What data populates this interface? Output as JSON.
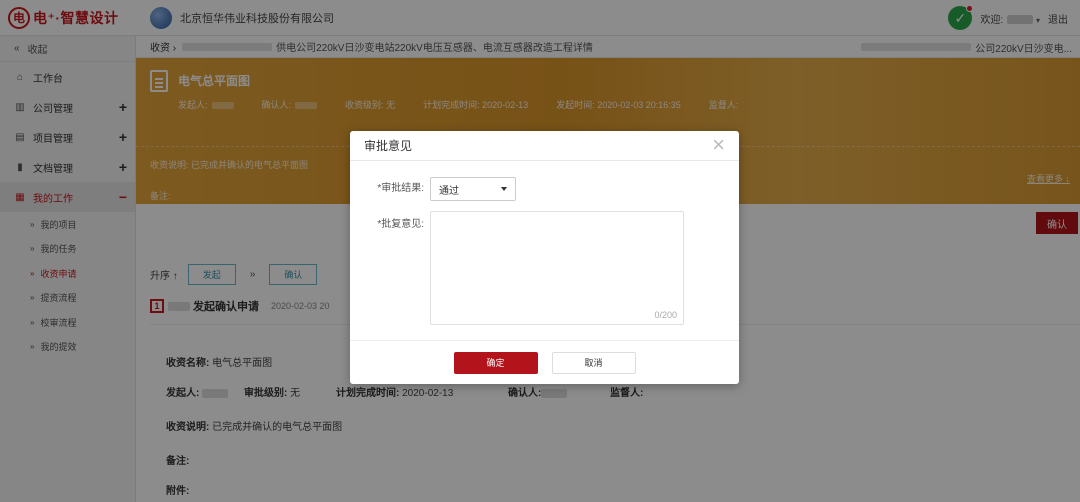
{
  "app": {
    "brand_logo_char": "电",
    "brand_text": "电⁺·智慧设计",
    "company_name": "北京恒华伟业科技股份有限公司",
    "welcome_label": "欢迎:",
    "logout_label": "退出"
  },
  "sidebar": {
    "collapse_label": "收起",
    "items": [
      {
        "label": "工作台",
        "icon": "home-icon"
      },
      {
        "label": "公司管理",
        "icon": "company-icon"
      },
      {
        "label": "项目管理",
        "icon": "project-icon"
      },
      {
        "label": "文档管理",
        "icon": "document-icon"
      },
      {
        "label": "我的工作",
        "icon": "work-icon"
      }
    ],
    "sub_items": [
      {
        "label": "我的项目"
      },
      {
        "label": "我的任务"
      },
      {
        "label": "收资申请"
      },
      {
        "label": "提资流程"
      },
      {
        "label": "校审流程"
      },
      {
        "label": "我的提效"
      }
    ]
  },
  "breadcrumb": {
    "home": "收资",
    "path_text": "供电公司220kV日沙变电站220kV电压互感器、电流互感器改造工程详情",
    "right_text": "公司220kV日沙变电..."
  },
  "banner": {
    "title": "电气总平面图",
    "meta": [
      {
        "label": "发起人:"
      },
      {
        "label": "确认人:"
      },
      {
        "label": "收资级别:",
        "value": "无"
      },
      {
        "label": "计划完成时间:",
        "value": "2020-02-13"
      },
      {
        "label": "发起时间:",
        "value": "2020-02-03 20:16:35"
      },
      {
        "label": "监督人:"
      }
    ],
    "desc": "收资说明: 已完成并确认的电气总平面图",
    "note_label": "备注:",
    "attach_label": "附件(0)",
    "more_link": "查看更多 ↓"
  },
  "confirm_button": "确认",
  "steps": {
    "sort_label": "升序",
    "step1": "发起",
    "separator": "»",
    "step2": "确认"
  },
  "record": {
    "number": "1",
    "title": "发起确认申请",
    "date": "2020-02-03 20",
    "name_label": "收资名称:",
    "name_value": "电气总平面图",
    "initiator_label": "发起人:",
    "level_label": "审批级别:",
    "level_value": "无",
    "plan_label": "计划完成时间:",
    "plan_value": "2020-02-13",
    "confirmer_label": "确认人:",
    "supervisor_label": "监督人:",
    "desc_label": "收资说明:",
    "desc_value": "已完成并确认的电气总平面图",
    "note_label": "备注:",
    "attach_label": "附件:"
  },
  "modal": {
    "title": "审批意见",
    "result_label": "*审批结果:",
    "result_value": "通过",
    "reply_label": "*批复意见:",
    "reply_value": "",
    "counter": "0/200",
    "ok_label": "确定",
    "cancel_label": "取消"
  },
  "colors": {
    "brand_red": "#c8161d",
    "banner_orange": "#dc9a30",
    "ok_red": "#b3141b"
  }
}
